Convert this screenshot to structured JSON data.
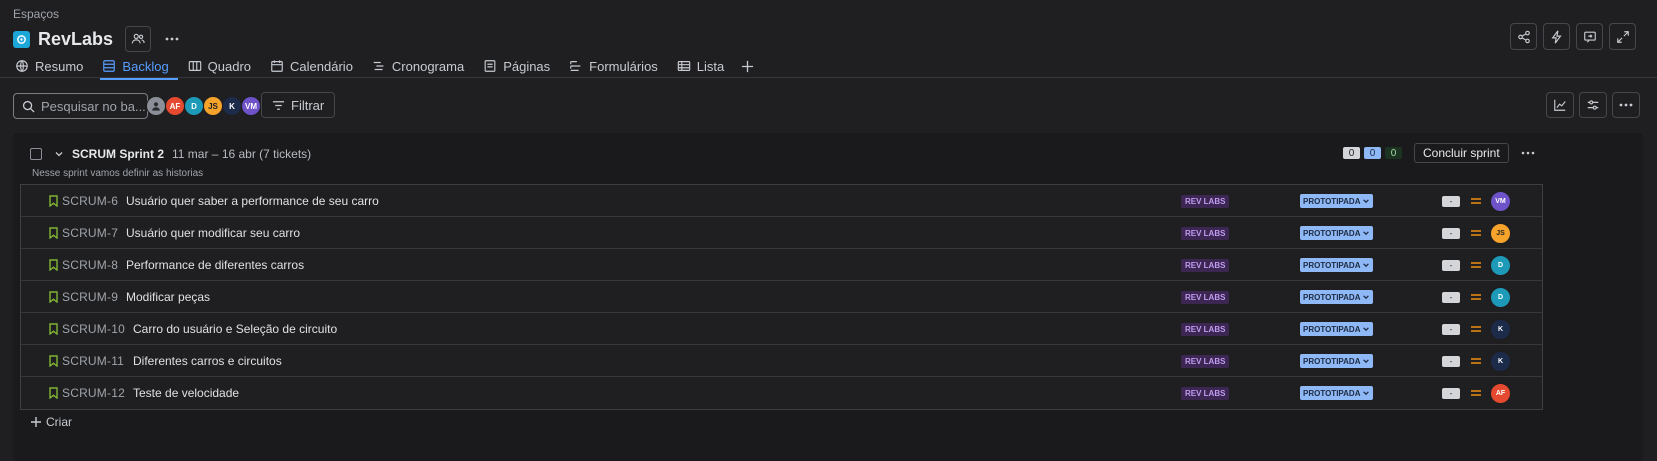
{
  "header": {
    "breadcrumb": "Espaços",
    "project_title": "RevLabs"
  },
  "tabs": [
    {
      "label": "Resumo",
      "icon": "globe-icon"
    },
    {
      "label": "Backlog",
      "icon": "backlog-icon",
      "active": true
    },
    {
      "label": "Quadro",
      "icon": "board-icon"
    },
    {
      "label": "Calendário",
      "icon": "calendar-icon"
    },
    {
      "label": "Cronograma",
      "icon": "timeline-icon"
    },
    {
      "label": "Páginas",
      "icon": "pages-icon"
    },
    {
      "label": "Formulários",
      "icon": "forms-icon"
    },
    {
      "label": "Lista",
      "icon": "list-icon"
    }
  ],
  "toolbar": {
    "search_placeholder": "Pesquisar no ba...",
    "filter_label": "Filtrar",
    "avatars": [
      {
        "initials": "",
        "color": "#8c8f97"
      },
      {
        "initials": "AF",
        "color": "#e5492f"
      },
      {
        "initials": "D",
        "color": "#1d9ab8"
      },
      {
        "initials": "JS",
        "color": "#f5a32b"
      },
      {
        "initials": "K",
        "color": "#1c2b4a"
      },
      {
        "initials": "VM",
        "color": "#6d52c9"
      }
    ]
  },
  "sprint": {
    "name": "SCRUM Sprint 2",
    "dates": "11 mar – 16 abr (7 tickets)",
    "description": "Nesse sprint vamos definir as historias",
    "counts": {
      "todo": "0",
      "in_progress": "0",
      "done": "0"
    },
    "conclude_label": "Concluir sprint"
  },
  "issues": [
    {
      "key": "SCRUM-6",
      "title": "Usuário quer saber a performance de seu carro",
      "epic": "REV LABS",
      "status": "PROTOTIPADA",
      "estimate": "-",
      "assignee": "VM",
      "assignee_color": "#6d52c9"
    },
    {
      "key": "SCRUM-7",
      "title": "Usuário quer modificar seu carro",
      "epic": "REV LABS",
      "status": "PROTOTIPADA",
      "estimate": "-",
      "assignee": "JS",
      "assignee_color": "#f5a32b"
    },
    {
      "key": "SCRUM-8",
      "title": "Performance de diferentes carros",
      "epic": "REV LABS",
      "status": "PROTOTIPADA",
      "estimate": "-",
      "assignee": "D",
      "assignee_color": "#1d9ab8"
    },
    {
      "key": "SCRUM-9",
      "title": "Modificar peças",
      "epic": "REV LABS",
      "status": "PROTOTIPADA",
      "estimate": "-",
      "assignee": "D",
      "assignee_color": "#1d9ab8"
    },
    {
      "key": "SCRUM-10",
      "title": "Carro do usuário e Seleção de circuito",
      "epic": "REV LABS",
      "status": "PROTOTIPADA",
      "estimate": "-",
      "assignee": "K",
      "assignee_color": "#1c2b4a"
    },
    {
      "key": "SCRUM-11",
      "title": "Diferentes carros e circuitos",
      "epic": "REV LABS",
      "status": "PROTOTIPADA",
      "estimate": "-",
      "assignee": "K",
      "assignee_color": "#1c2b4a"
    },
    {
      "key": "SCRUM-12",
      "title": "Teste de velocidade",
      "epic": "REV LABS",
      "status": "PROTOTIPADA",
      "estimate": "-",
      "assignee": "AF",
      "assignee_color": "#e5492f"
    }
  ],
  "create_label": "Criar"
}
